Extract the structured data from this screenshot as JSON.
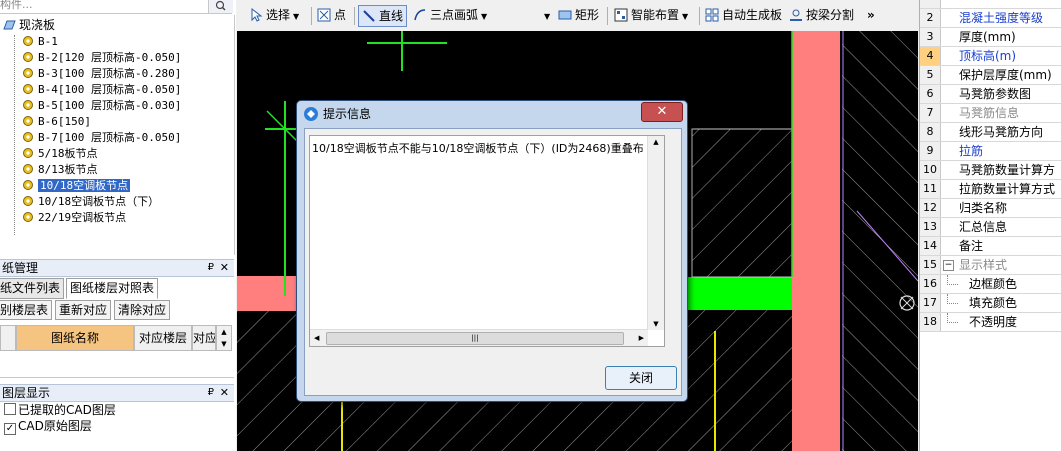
{
  "left_panel": {
    "search_placeholder": "构件...",
    "tree_root": "现浇板",
    "tree_items": [
      "B-1",
      "B-2[120 层顶标高-0.050]",
      "B-3[100 层顶标高-0.280]",
      "B-4[100 层顶标高-0.050]",
      "B-5[100 层顶标高-0.030]",
      "B-6[150]",
      "B-7[100 层顶标高-0.050]",
      "5/18板节点",
      "8/13板节点",
      "10/18空调板节点",
      "10/18空调板节点（下）",
      "22/19空调板节点"
    ],
    "selected_index": 9
  },
  "drawing_panel": {
    "title": "纸管理",
    "tabs": [
      "纸文件列表",
      "图纸楼层对照表"
    ],
    "active_tab": 1,
    "buttons": [
      "别楼层表",
      "重新对应",
      "清除对应"
    ],
    "columns": [
      "图纸名称",
      "对应楼层",
      "对应"
    ]
  },
  "layer_panel": {
    "title": "图层显示",
    "items": [
      {
        "label": "已提取的CAD图层",
        "checked": false
      },
      {
        "label": "CAD原始图层",
        "checked": true
      }
    ]
  },
  "toolbar": {
    "select": "选择",
    "point": "点",
    "line": "直线",
    "arc": "三点画弧",
    "rect": "矩形",
    "smart": "智能布置",
    "auto_gen": "自动生成板",
    "split_beam": "按梁分割",
    "more": "»"
  },
  "properties": {
    "rows": [
      {
        "num": "2",
        "name": "混凝土强度等级",
        "style": "blue",
        "indent": 0
      },
      {
        "num": "3",
        "name": "厚度(mm)",
        "style": "normal",
        "indent": 0
      },
      {
        "num": "4",
        "name": "顶标高(m)",
        "style": "blue",
        "indent": 0,
        "selected": true
      },
      {
        "num": "5",
        "name": "保护层厚度(mm)",
        "style": "normal",
        "indent": 0
      },
      {
        "num": "6",
        "name": "马凳筋参数图",
        "style": "normal",
        "indent": 0
      },
      {
        "num": "7",
        "name": "马凳筋信息",
        "style": "gray",
        "indent": 0
      },
      {
        "num": "8",
        "name": "线形马凳筋方向",
        "style": "normal",
        "indent": 0
      },
      {
        "num": "9",
        "name": "拉筋",
        "style": "blue",
        "indent": 0
      },
      {
        "num": "10",
        "name": "马凳筋数量计算方",
        "style": "normal",
        "indent": 0
      },
      {
        "num": "11",
        "name": "拉筋数量计算方式",
        "style": "normal",
        "indent": 0
      },
      {
        "num": "12",
        "name": "归类名称",
        "style": "normal",
        "indent": 0
      },
      {
        "num": "13",
        "name": "汇总信息",
        "style": "normal",
        "indent": 0
      },
      {
        "num": "14",
        "name": "备注",
        "style": "normal",
        "indent": 0
      },
      {
        "num": "15",
        "name": "显示样式",
        "style": "gray",
        "indent": 0,
        "group": true
      },
      {
        "num": "16",
        "name": "边框颜色",
        "style": "normal",
        "indent": 1
      },
      {
        "num": "17",
        "name": "填充颜色",
        "style": "normal",
        "indent": 1
      },
      {
        "num": "18",
        "name": "不透明度",
        "style": "normal",
        "indent": 1
      }
    ]
  },
  "dialog": {
    "title": "提示信息",
    "message": "10/18空调板节点不能与10/18空调板节点（下）(ID为2468)重叠布",
    "close_symbol": "✕",
    "ok_label": "关闭"
  },
  "colors": {
    "canvas_bg": "#000000",
    "pink_wall": "#ff7f7f",
    "green_slab": "#00ff00",
    "dialog_frame": "#c5d7ec",
    "selection": "#3168c8"
  }
}
